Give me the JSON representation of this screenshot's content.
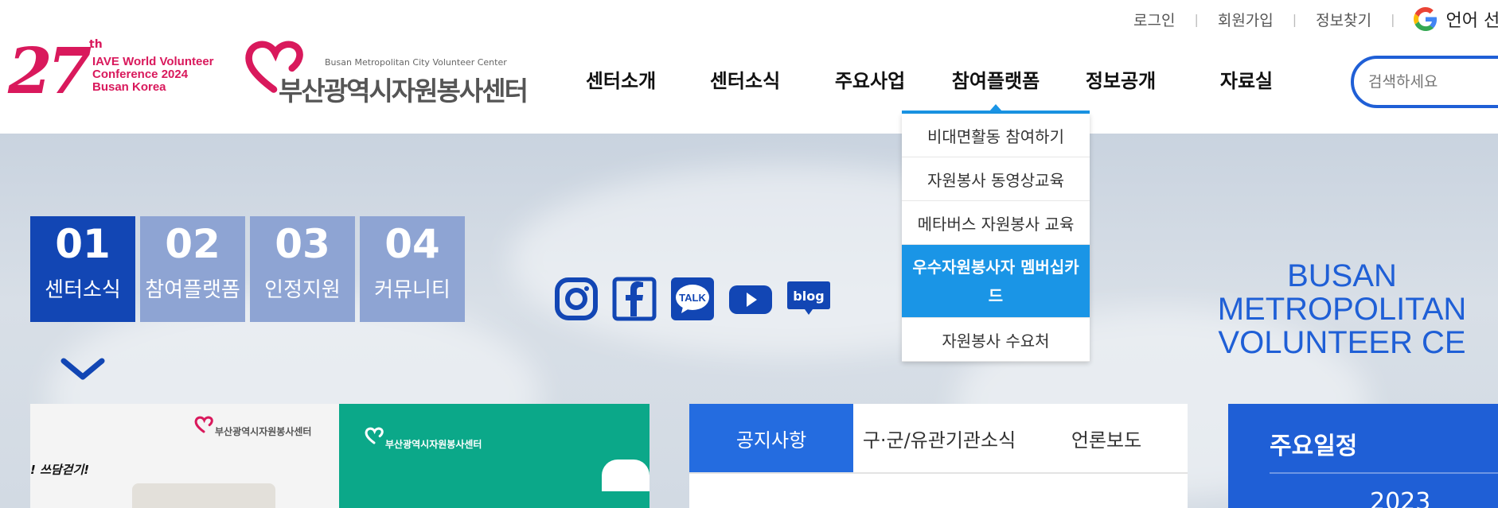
{
  "util": {
    "login": "로그인",
    "signup": "회원가입",
    "find": "정보찾기",
    "language": "언어 선"
  },
  "logo27": {
    "num": "27",
    "th": "th",
    "conference": "IAVE World Volunteer\nConference 2024\nBusan Korea"
  },
  "logo_center": {
    "en": "Busan Metropolitan City Volunteer Center",
    "ko": "부산광역시자원봉사센터"
  },
  "gnb": [
    "센터소개",
    "센터소식",
    "주요사업",
    "참여플랫폼",
    "정보공개",
    "자료실"
  ],
  "search": {
    "placeholder": "검색하세요"
  },
  "dropdown": [
    "비대면활동 참여하기",
    "자원봉사 동영상교육",
    "메타버스 자원봉사 교육",
    "우수자원봉사자 멤버십카드",
    "자원봉사 수요처"
  ],
  "tabs": [
    {
      "num": "01",
      "label": "센터소식"
    },
    {
      "num": "02",
      "label": "참여플랫폼"
    },
    {
      "num": "03",
      "label": "인정지원"
    },
    {
      "num": "04",
      "label": "커뮤니티"
    }
  ],
  "social": [
    "instagram-icon",
    "facebook-icon",
    "kakaotalk-icon",
    "youtube-icon",
    "blog-icon"
  ],
  "social_text": {
    "talk": "TALK",
    "blog": "blog"
  },
  "busan_text": "BUSAN METROPOLITAN\nVOLUNTEER CE",
  "banner": {
    "slogan": "! 쓰담걷기!",
    "logo_left": "부산광역시자원봉사센터",
    "logo_right": "부산광역시자원봉사센터"
  },
  "news_tabs": [
    "공지사항",
    "구·군/유관기관소식",
    "언론보도"
  ],
  "schedule": {
    "title": "주요일정",
    "year": "2023"
  },
  "colors": {
    "brand_blue": "#1f5fd6",
    "accent_blue": "#1a95e6",
    "tab_active": "#1246b4",
    "tab_inactive": "#8ea4d3",
    "iave_pink": "#d9195c",
    "banner_green": "#0ba889"
  }
}
